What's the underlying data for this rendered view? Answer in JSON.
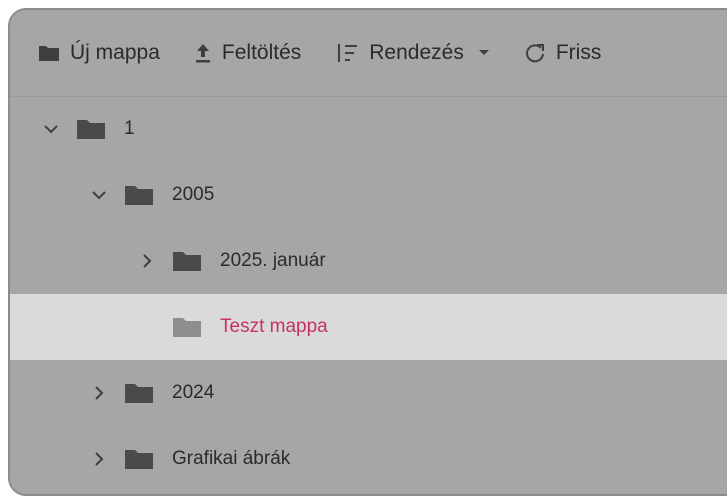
{
  "toolbar": {
    "new_folder_label": "Új mappa",
    "upload_label": "Feltöltés",
    "sort_label": "Rendezés",
    "refresh_label": "Friss"
  },
  "tree": [
    {
      "label": "1",
      "level": 0,
      "chevron": "down",
      "selected": false
    },
    {
      "label": "2005",
      "level": 1,
      "chevron": "down",
      "selected": false
    },
    {
      "label": "2025. január",
      "level": 2,
      "chevron": "right",
      "selected": false
    },
    {
      "label": "Teszt mappa",
      "level": 2,
      "chevron": "none",
      "selected": true
    },
    {
      "label": "2024",
      "level": 1,
      "chevron": "right",
      "selected": false
    },
    {
      "label": "Grafikai ábrák",
      "level": 1,
      "chevron": "right",
      "selected": false
    }
  ],
  "colors": {
    "panel_bg": "#a6a6a6",
    "selected_bg": "#dadada",
    "selected_text": "#c8306a",
    "icon": "#4a4a4a"
  },
  "icons": [
    "folder-icon",
    "upload-icon",
    "sort-icon",
    "caret-down-icon",
    "refresh-icon",
    "chevron-down-icon",
    "chevron-right-icon"
  ]
}
